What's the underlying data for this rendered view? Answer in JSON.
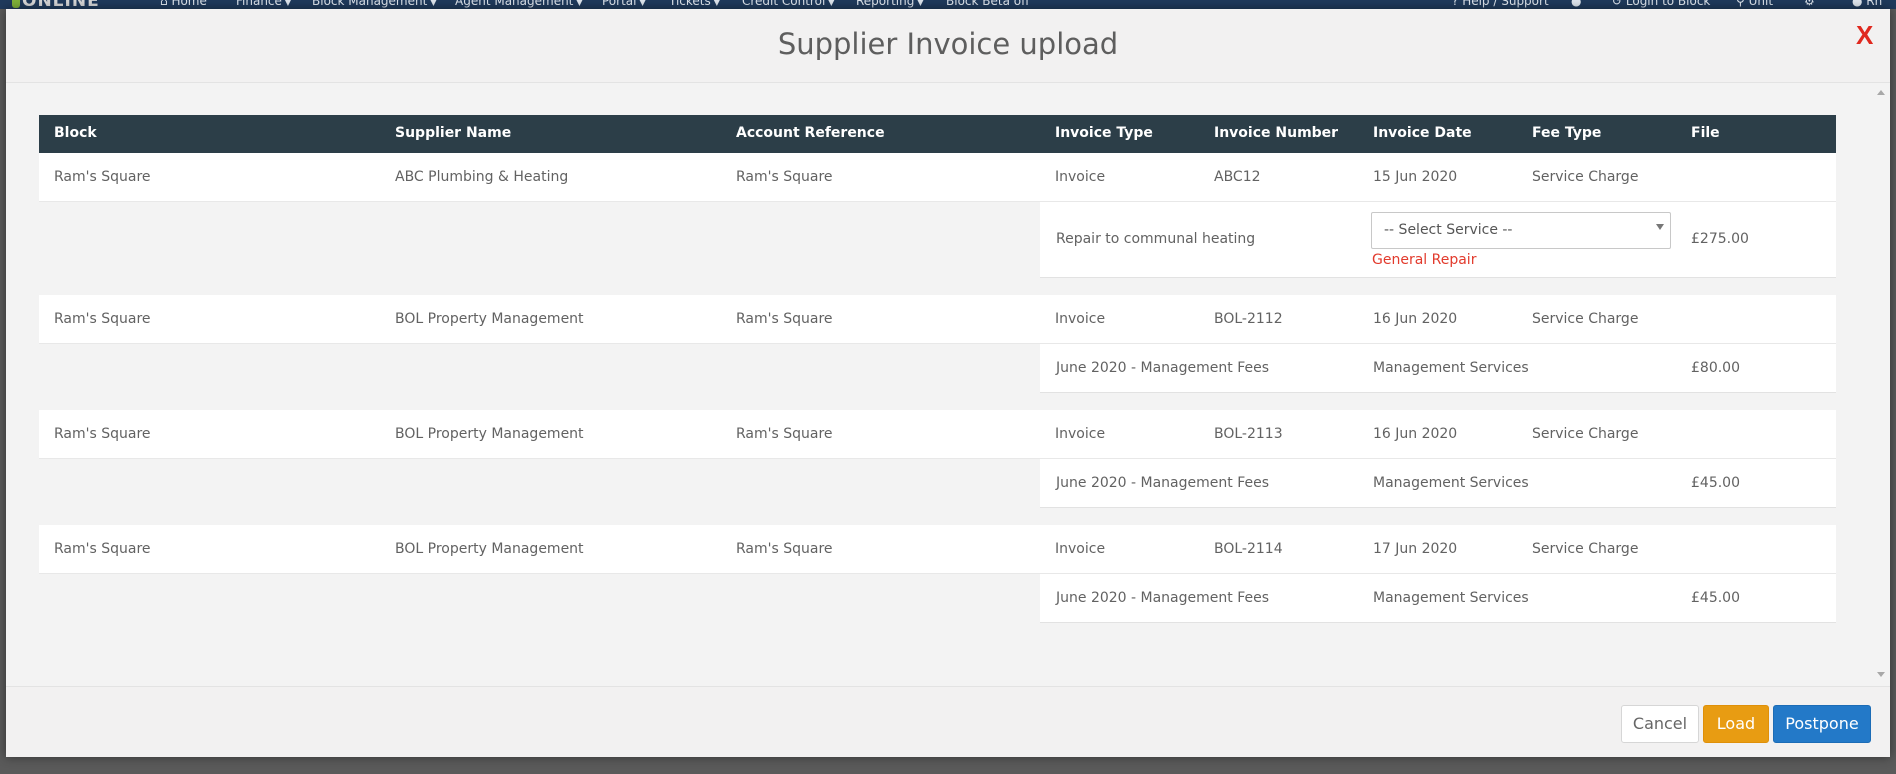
{
  "background_nav": {
    "logo": "ONLINE",
    "items": [
      {
        "label": "Home"
      },
      {
        "label": "Finance"
      },
      {
        "label": "Block Management"
      },
      {
        "label": "Agent Management"
      },
      {
        "label": "Portal"
      },
      {
        "label": "Tickets"
      },
      {
        "label": "Credit Control"
      },
      {
        "label": "Reporting"
      },
      {
        "label": "Block Beta off"
      },
      {
        "label": "Help / Support"
      },
      {
        "label": "Login to Block"
      },
      {
        "label": "Unit"
      },
      {
        "label": "Rn"
      }
    ]
  },
  "modal": {
    "title": "Supplier Invoice upload",
    "close_label": "X"
  },
  "table": {
    "headers": {
      "block": "Block",
      "supplier_name": "Supplier Name",
      "account_reference": "Account Reference",
      "invoice_type": "Invoice Type",
      "invoice_number": "Invoice Number",
      "invoice_date": "Invoice Date",
      "fee_type": "Fee Type",
      "file": "File"
    },
    "invoices": [
      {
        "block": "Ram's Square",
        "supplier": "ABC Plumbing & Heating",
        "account_reference": "Ram's Square",
        "invoice_type": "Invoice",
        "invoice_number": "ABC12",
        "invoice_date": "15 Jun 2020",
        "fee_type": "Service Charge",
        "line": {
          "description": "Repair to communal heating",
          "service_placeholder": "-- Select Service --",
          "service_error": "General Repair",
          "amount": "£275.00"
        }
      },
      {
        "block": "Ram's Square",
        "supplier": "BOL Property Management",
        "account_reference": "Ram's Square",
        "invoice_type": "Invoice",
        "invoice_number": "BOL-2112",
        "invoice_date": "16 Jun 2020",
        "fee_type": "Service Charge",
        "line": {
          "description": "June 2020 - Management Fees",
          "service": "Management Services",
          "amount": "£80.00"
        }
      },
      {
        "block": "Ram's Square",
        "supplier": "BOL Property Management",
        "account_reference": "Ram's Square",
        "invoice_type": "Invoice",
        "invoice_number": "BOL-2113",
        "invoice_date": "16 Jun 2020",
        "fee_type": "Service Charge",
        "line": {
          "description": "June 2020 - Management Fees",
          "service": "Management Services",
          "amount": "£45.00"
        }
      },
      {
        "block": "Ram's Square",
        "supplier": "BOL Property Management",
        "account_reference": "Ram's Square",
        "invoice_type": "Invoice",
        "invoice_number": "BOL-2114",
        "invoice_date": "17 Jun 2020",
        "fee_type": "Service Charge",
        "line": {
          "description": "June 2020 - Management Fees",
          "service": "Management Services",
          "amount": "£45.00"
        }
      }
    ]
  },
  "footer": {
    "cancel_label": "Cancel",
    "load_label": "Load",
    "postpone_label": "Postpone"
  },
  "colors": {
    "table_header_bg": "#2c3e48",
    "close_red": "#e0281e",
    "error_red": "#e23a2c",
    "load_orange": "#e89c12",
    "postpone_blue": "#2379c8",
    "nav_bg": "#1f3a5c"
  }
}
